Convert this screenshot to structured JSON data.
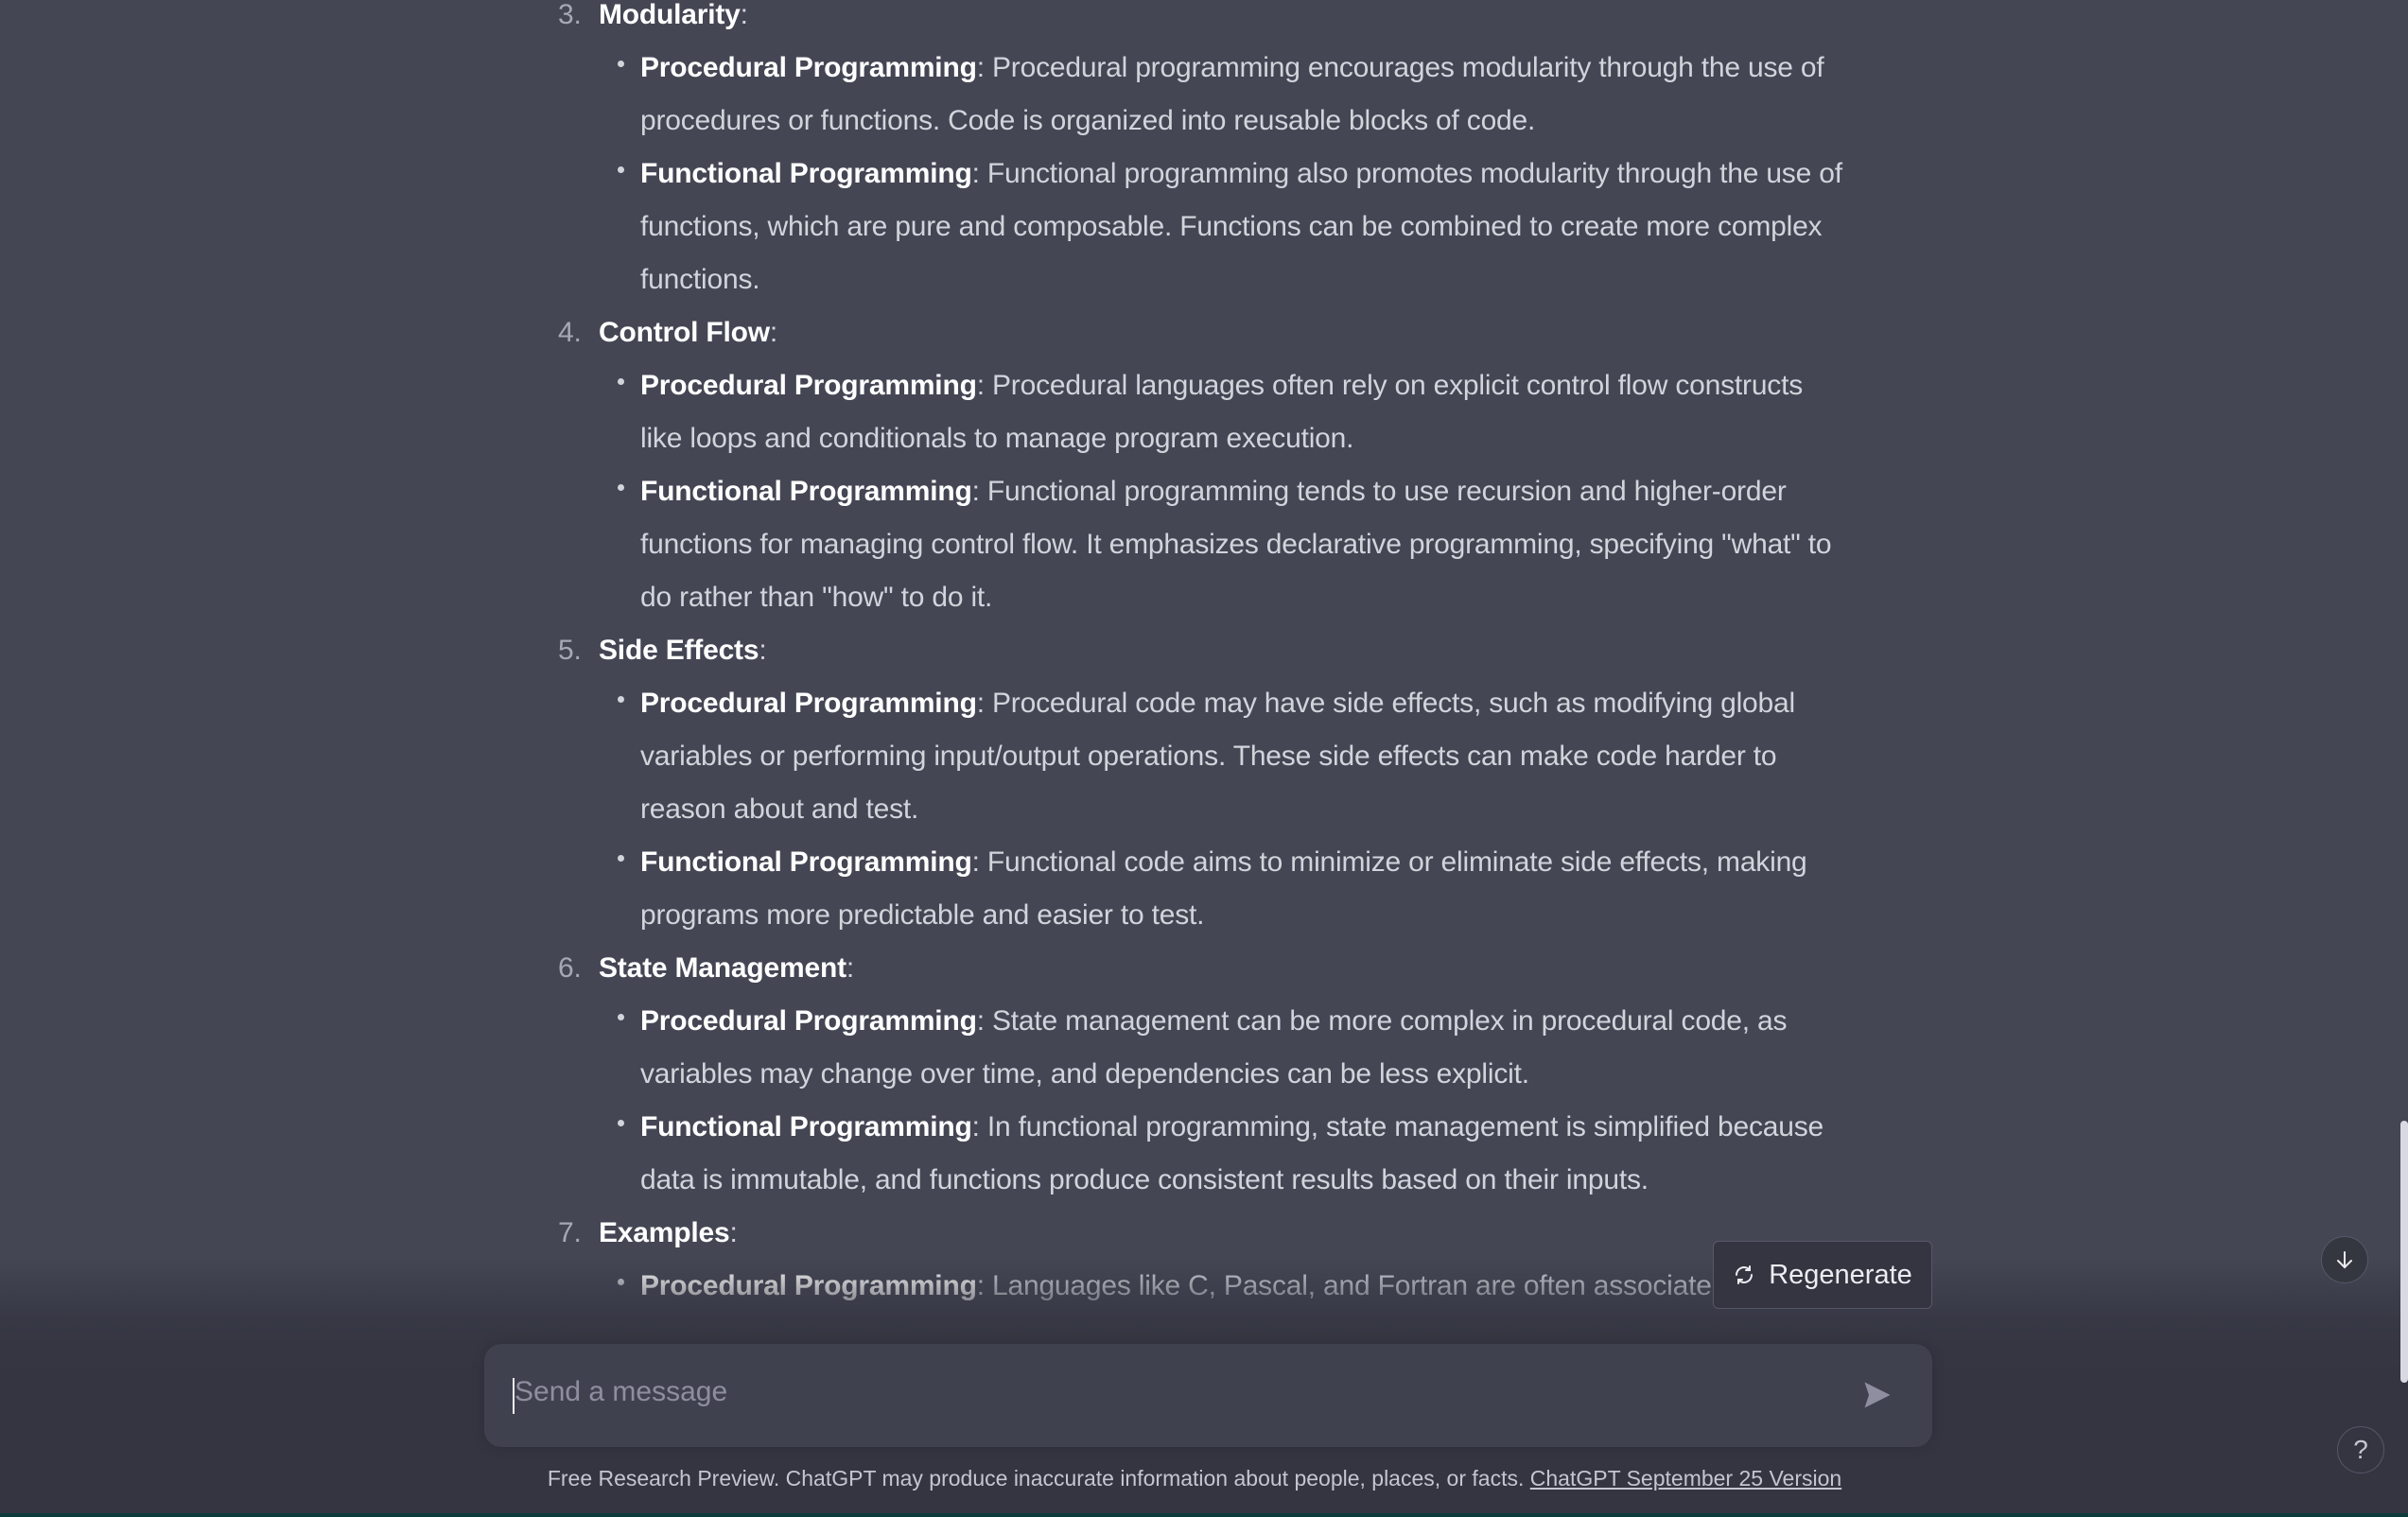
{
  "sections": [
    {
      "num": "3.",
      "title": "Modularity",
      "points": [
        {
          "label": "Procedural Programming",
          "text": "Procedural programming encourages modularity through the use of procedures or functions. Code is organized into reusable blocks of code."
        },
        {
          "label": "Functional Programming",
          "text": "Functional programming also promotes modularity through the use of functions, which are pure and composable. Functions can be combined to create more complex functions."
        }
      ]
    },
    {
      "num": "4.",
      "title": "Control Flow",
      "points": [
        {
          "label": "Procedural Programming",
          "text": "Procedural languages often rely on explicit control flow constructs like loops and conditionals to manage program execution."
        },
        {
          "label": "Functional Programming",
          "text": "Functional programming tends to use recursion and higher-order functions for managing control flow. It emphasizes declarative programming, specifying \"what\" to do rather than \"how\" to do it."
        }
      ]
    },
    {
      "num": "5.",
      "title": "Side Effects",
      "points": [
        {
          "label": "Procedural Programming",
          "text": "Procedural code may have side effects, such as modifying global variables or performing input/output operations. These side effects can make code harder to reason about and test."
        },
        {
          "label": "Functional Programming",
          "text": "Functional code aims to minimize or eliminate side effects, making programs more predictable and easier to test."
        }
      ]
    },
    {
      "num": "6.",
      "title": "State Management",
      "points": [
        {
          "label": "Procedural Programming",
          "text": "State management can be more complex in procedural code, as variables may change over time, and dependencies can be less explicit."
        },
        {
          "label": "Functional Programming",
          "text": "In functional programming, state management is simplified because data is immutable, and functions produce consistent results based on their inputs."
        }
      ]
    },
    {
      "num": "7.",
      "title": "Examples",
      "points": [
        {
          "label": "Procedural Programming",
          "text": "Languages like C, Pascal, and Fortran are often associated"
        }
      ]
    }
  ],
  "regenerate_label": "Regenerate",
  "input": {
    "placeholder": "Send a message"
  },
  "footer": {
    "text": "Free Research Preview. ChatGPT may produce inaccurate information about people, places, or facts.",
    "link": "ChatGPT September 25 Version"
  },
  "help_label": "?",
  "icons": {
    "regenerate": "refresh-icon",
    "send": "send-icon",
    "scroll_down": "arrow-down-icon",
    "help": "question-icon"
  },
  "colors": {
    "background": "#444654",
    "input": "#40414f",
    "page_bottom": "#343541"
  }
}
